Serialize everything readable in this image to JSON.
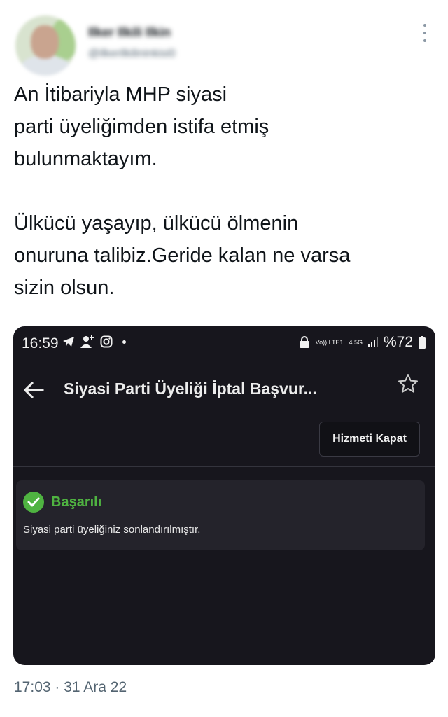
{
  "tweet": {
    "author_name": "Ilker Ilkili Ilkin",
    "author_handle": "@ilkerilkilininkisi0",
    "lines_para1": [
      "An İtibariyla MHP siyasi",
      "parti üyeliğimden istifa etmiş",
      "bulunmaktayım."
    ],
    "lines_para2": [
      "Ülkücü yaşayıp, ülkücü ölmenin",
      "onuruna talibiz.Geride kalan ne varsa",
      "sizin olsun."
    ],
    "timestamp": "17:03 · 31 Ara 22",
    "more_icon": "more-vertical-icon"
  },
  "phone": {
    "status_bar": {
      "time": "16:59",
      "volte": "Vo)) LTE1",
      "network": "4.5G",
      "battery": "%72",
      "icons": [
        "telegram-icon",
        "person-add-icon",
        "instagram-icon",
        "dot-icon",
        "lock-icon",
        "signal-icon",
        "battery-icon"
      ]
    },
    "app_bar": {
      "title": "Siyasi Parti Üyeliği İptal Başvur...",
      "back_icon": "arrow-left-icon",
      "star_icon": "star-outline-icon"
    },
    "close_button": "Hizmeti Kapat",
    "alert": {
      "title": "Başarılı",
      "message": "Siyasi parti üyeliğiniz sonlandırılmıştır.",
      "color": "#4fb341"
    },
    "theme": {
      "background": "#17161d",
      "card": "#24232b"
    }
  }
}
